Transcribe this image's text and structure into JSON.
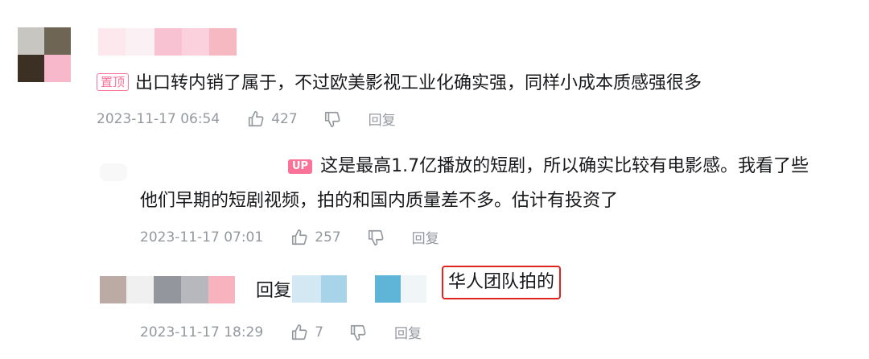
{
  "comments": [
    {
      "pin_label": "置顶",
      "text": "出口转内销了属于，不过欧美影视工业化确实强，同样小成本质感强很多",
      "time": "2023-11-17 06:54",
      "likes": "427",
      "reply_label": "回复"
    },
    {
      "up_label": "UP",
      "text_line1": "这是最高1.7亿播放的短剧，所以确实比较有电影感。我看了些",
      "text_line2": "他们早期的短剧视频，拍的和国内质量差不多。估计有投资了",
      "time": "2023-11-17 07:01",
      "likes": "257",
      "reply_label": "回复"
    },
    {
      "reply_prefix": "回复",
      "text": "华人团队拍的",
      "time": "2023-11-17 18:29",
      "likes": "7",
      "reply_label": "回复"
    }
  ],
  "colors": {
    "accent_pink": "#fb7299",
    "meta_gray": "#9499a0",
    "highlight_red": "#e0251d"
  },
  "icons": [
    "thumbs-up-icon",
    "thumbs-down-icon"
  ]
}
